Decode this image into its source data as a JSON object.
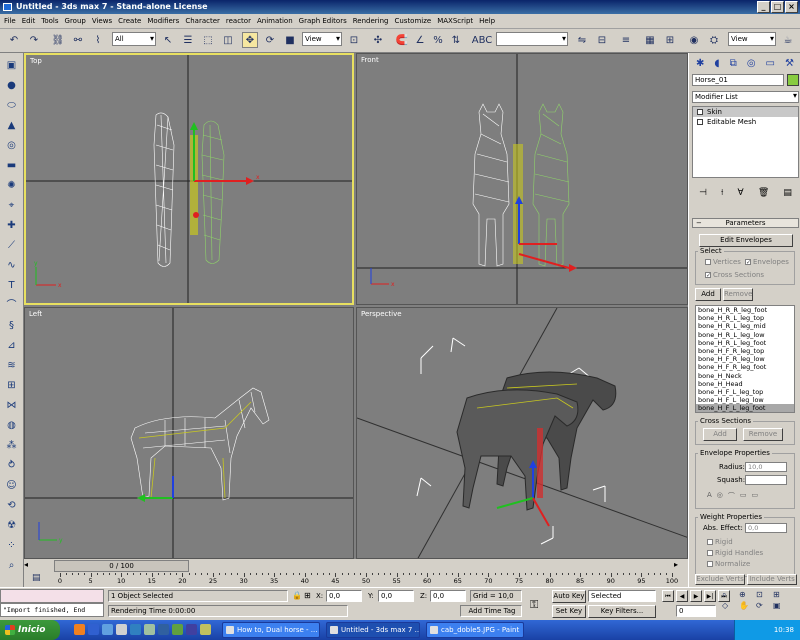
{
  "title": "Untitled  - 3ds max 7  - Stand-alone License",
  "menu": [
    "File",
    "Edit",
    "Tools",
    "Group",
    "Views",
    "Create",
    "Modifiers",
    "Character",
    "reactor",
    "Animation",
    "Graph Editors",
    "Rendering",
    "Customize",
    "MAXScript",
    "Help"
  ],
  "toolbar": {
    "selection_filter": "All",
    "ref_coord": "View",
    "named_selection": "",
    "view_dropdown_right": "View"
  },
  "viewports": {
    "top": "Top",
    "front": "Front",
    "left": "Left",
    "perspective": "Perspective"
  },
  "command_panel": {
    "object_name": "Horse_01",
    "modifier_list": "Modifier List",
    "stack": [
      "Skin",
      "Editable Mesh"
    ],
    "parameters_title": "Parameters",
    "edit_envelopes": "Edit Envelopes",
    "select_label": "Select",
    "vertices": "Vertices",
    "envelopes": "Envelopes",
    "cross_sections_chk": "Cross Sections",
    "add": "Add",
    "remove": "Remove",
    "bones": [
      "bone_H_R_R_leg_foot",
      "bone_H_R_L_leg_top",
      "bone_H_R_L_leg_mid",
      "bone_H_R_L_leg_low",
      "bone_H_R_L_leg_foot",
      "bone_H_F_R_leg_top",
      "bone_H_F_R_leg_low",
      "bone_H_F_R_leg_foot",
      "bone_H_Neck",
      "bone_H_Head",
      "bone_H_F_L_leg_top",
      "bone_H_F_L_leg_low",
      "bone_H_F_L_leg_foot"
    ],
    "selected_bone_index": 12,
    "cross_sections_group": "Cross Sections",
    "cs_add": "Add",
    "cs_remove": "Remove",
    "envelope_props": "Envelope Properties",
    "radius_label": "Radius:",
    "radius_value": "10,0",
    "squash_label": "Squash:",
    "weight_props": "Weight Properties",
    "abs_effect_label": "Abs. Effect:",
    "abs_effect_value": "0,0",
    "rigid": "Rigid",
    "rigid_handles": "Rigid Handles",
    "normalize": "Normalize",
    "exclude_verts": "Exclude Verts",
    "include_verts": "Include Verts"
  },
  "timeline": {
    "slider": "0 / 100",
    "ticks": [
      "0",
      "5",
      "10",
      "15",
      "20",
      "25",
      "30",
      "35",
      "40",
      "45",
      "50",
      "55",
      "60",
      "65",
      "70",
      "75",
      "80",
      "85",
      "90",
      "95",
      "100"
    ]
  },
  "status": {
    "listener_top": "",
    "listener": "\"Import finished, End",
    "selection": "1 Object Selected",
    "prompt": "Rendering Time  0:00:00",
    "x_label": "X:",
    "x_value": "0,0",
    "y_label": "Y:",
    "y_value": "0,0",
    "z_label": "Z:",
    "z_value": "0,0",
    "grid": "Grid = 10,0",
    "add_time_tag": "Add Time Tag",
    "auto_key": "Auto Key",
    "set_key": "Set Key",
    "key_mode": "Selected",
    "key_filters": "Key Filters...",
    "frame": "0"
  },
  "taskbar": {
    "start": "Inicio",
    "items": [
      "How to, Dual horse - ...",
      "Untitled - 3ds max 7 ...",
      "cab_doble5.JPG - Paint"
    ],
    "active_index": 1,
    "clock": "10:38"
  },
  "colors": {
    "viewport_bg": "#7e7e7e",
    "active_border": "#e8e060",
    "wire_white": "#ffffff",
    "wire_green": "#8fd46a",
    "bones": "#c8c820",
    "taskbar": "#245edb"
  }
}
